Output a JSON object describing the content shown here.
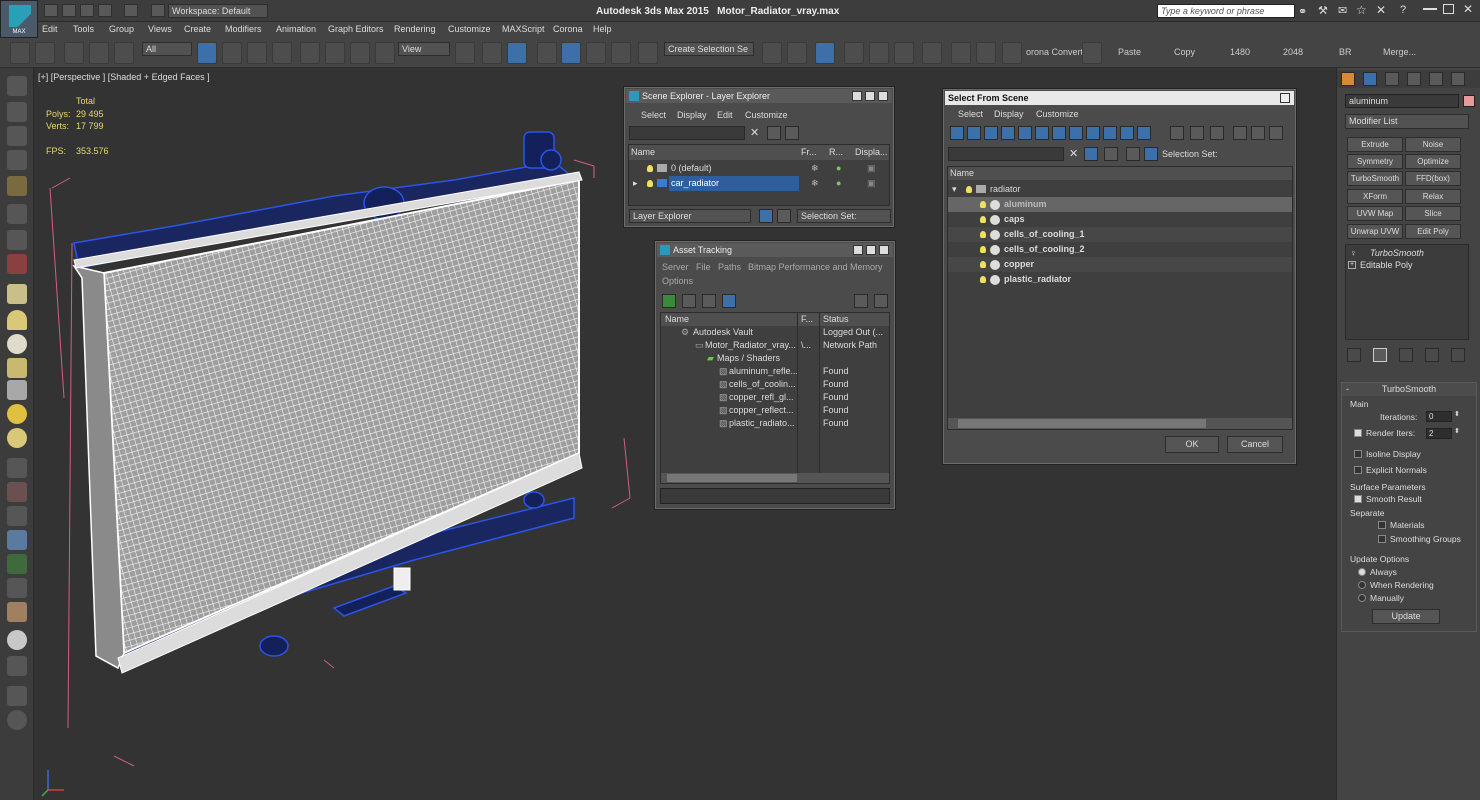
{
  "app": {
    "title": "Autodesk 3ds Max  2015",
    "file": "Motor_Radiator_vray.max",
    "workspace": "Workspace: Default",
    "search_placeholder": "Type a keyword or phrase",
    "logo_text": "MAX"
  },
  "menu": [
    "Edit",
    "Tools",
    "Group",
    "Views",
    "Create",
    "Modifiers",
    "Animation",
    "Graph Editors",
    "Rendering",
    "Customize",
    "MAXScript",
    "Corona",
    "Help"
  ],
  "toolbar": {
    "filter": "All",
    "refcoord": "View",
    "selection_set": "Create Selection Se",
    "corona_convert": "orona Convert",
    "paste": "Paste",
    "copy": "Copy",
    "w": "1480",
    "h": "2048",
    "br": "BR",
    "merge": "Merge..."
  },
  "viewport": {
    "label": "[+] [Perspective ] [Shaded + Edged Faces ]",
    "stats": {
      "total": "Total",
      "polys_label": "Polys:",
      "polys": "29 495",
      "verts_label": "Verts:",
      "verts": "17 799",
      "fps_label": "FPS:",
      "fps": "353.576"
    }
  },
  "scene_explorer": {
    "title": "Scene Explorer - Layer Explorer",
    "menu": [
      "Select",
      "Display",
      "Edit",
      "Customize"
    ],
    "columns": [
      "Name",
      "Fr...",
      "R...",
      "Displa..."
    ],
    "rows": [
      {
        "name": "0 (default)"
      },
      {
        "name": "car_radiator"
      }
    ],
    "footer_dropdown": "Layer Explorer",
    "selection_set": "Selection Set:"
  },
  "asset_tracking": {
    "title": "Asset Tracking",
    "menu": [
      "Server",
      "File",
      "Paths",
      "Bitmap Performance and Memory",
      "Options"
    ],
    "columns": [
      "Name",
      "F...",
      "Status"
    ],
    "rows": [
      {
        "name": "Autodesk Vault",
        "f": "",
        "status": "Logged Out (..."
      },
      {
        "name": "Motor_Radiator_vray...",
        "f": "\\...",
        "status": "Network Path"
      },
      {
        "name": "Maps / Shaders",
        "f": "",
        "status": ""
      },
      {
        "name": "aluminum_refle...",
        "f": "",
        "status": "Found"
      },
      {
        "name": "cells_of_coolin...",
        "f": "",
        "status": "Found"
      },
      {
        "name": "copper_refl_gl...",
        "f": "",
        "status": "Found"
      },
      {
        "name": "copper_reflect...",
        "f": "",
        "status": "Found"
      },
      {
        "name": "plastic_radiato...",
        "f": "",
        "status": "Found"
      }
    ]
  },
  "select_from_scene": {
    "title": "Select From Scene",
    "menu": [
      "Select",
      "Display",
      "Customize"
    ],
    "selection_set": "Selection Set:",
    "column": "Name",
    "root": "radiator",
    "items": [
      "aluminum",
      "caps",
      "cells_of_cooling_1",
      "cells_of_cooling_2",
      "copper",
      "plastic_radiator"
    ],
    "ok": "OK",
    "cancel": "Cancel"
  },
  "command_panel": {
    "object_name": "aluminum",
    "object_color": "#e89a9a",
    "modifier_list": "Modifier List",
    "buttons": [
      "Extrude",
      "Noise",
      "Symmetry",
      "Optimize",
      "TurboSmooth",
      "FFD(box)",
      "XForm",
      "Relax",
      "UVW Map",
      "Slice",
      "Unwrap UVW",
      "Edit Poly"
    ],
    "stack": [
      "TurboSmooth",
      "Editable Poly"
    ],
    "rollout_title": "TurboSmooth",
    "main": "Main",
    "iterations_label": "Iterations:",
    "iterations": "0",
    "render_iters_label": "Render Iters:",
    "render_iters": "2",
    "isoline": "Isoline Display",
    "explicit_normals": "Explicit Normals",
    "surface_params": "Surface Parameters",
    "smooth_result": "Smooth Result",
    "separate": "Separate",
    "materials": "Materials",
    "smoothing_groups": "Smoothing Groups",
    "update_options": "Update Options",
    "always": "Always",
    "when_rendering": "When Rendering",
    "manually": "Manually",
    "update": "Update"
  }
}
